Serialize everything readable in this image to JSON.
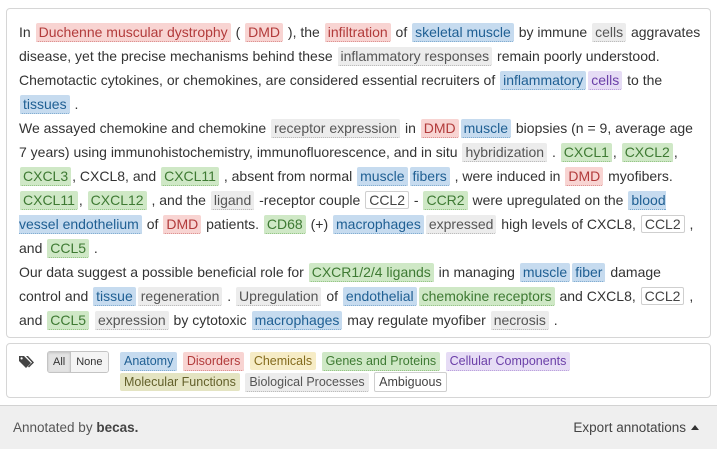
{
  "abstract": {
    "p1": {
      "s1": "In ",
      "e1": "Duchenne muscular dystrophy",
      "s2": " ( ",
      "e2": "DMD",
      "s3": " ), the ",
      "e3": "infiltration",
      "s4": " of ",
      "e4": "skeletal muscle",
      "s5": " by immune ",
      "e5": "cells",
      "s6": " aggravates disease, yet the precise mechanisms behind these ",
      "e6": "inflammatory responses",
      "s7": " remain poorly understood. Chemotactic cytokines, or chemokines, are considered essential recruiters of ",
      "e7a": "inflammatory",
      "e7b": "cells",
      "s8": " to the ",
      "e8": "tissues",
      "s9": " ."
    },
    "p2": {
      "s1": "We assayed chemokine and chemokine ",
      "e1": "receptor expression",
      "s2": " in ",
      "e2": "DMD",
      "e3": "muscle",
      "s3": " biopsies (n = 9, average age 7 years) using immunohistochemistry, immunofluorescence, and in situ ",
      "e4": "hybridization",
      "s4": " .",
      "g1": "CXCL1",
      "g2": "CXCL2",
      "g3": "CXCL3",
      "s5": ", CXCL8, and ",
      "g4": "CXCL11",
      "s6": " , absent from normal ",
      "e5": "muscle",
      "e6": "fibers",
      "s7": " , were induced in ",
      "e7": "DMD",
      "s8": " myofibers. ",
      "g5": "CXCL11",
      "g6": "CXCL12",
      "s9": " , and the ",
      "e8": "ligand",
      "s10": " -receptor couple ",
      "e9": "CCL2",
      "s11": " - ",
      "g7": "CCR2",
      "s12": " were upregulated on the ",
      "e10": "blood vessel endothelium",
      "s13": " of ",
      "e11": "DMD",
      "s14": " patients. ",
      "g8": "CD68",
      "s15": " (+) ",
      "e12": "macrophages",
      "e13": "expressed",
      "s16": " high levels of CXCL8, ",
      "e14": "CCL2",
      "s17": " , and ",
      "g9": "CCL5",
      "s18": " ."
    },
    "p3": {
      "s1": "Our data suggest a possible beneficial role for ",
      "g1": "CXCR1/2/4 ligands",
      "s2": " in managing ",
      "e1": "muscle",
      "e2": "fiber",
      "s3": " damage control and ",
      "e3": "tissue",
      "e4": "regeneration",
      "s4": " . ",
      "e5": "Upregulation",
      "s5": " of ",
      "e6": "endothelial",
      "e7": "chemokine receptors",
      "s6": " and CXCL8, ",
      "e8": "CCL2",
      "s7": " , and ",
      "g2": "CCL5",
      "e9": "expression",
      "s8": " by cytotoxic ",
      "e10": "macrophages",
      "s9": " may regulate myofiber ",
      "e11": "necrosis",
      "s10": " ."
    }
  },
  "legend": {
    "icon": "tags-icon",
    "all_label": "All",
    "none_label": "None",
    "items": [
      {
        "label": "Anatomy",
        "color": "#c6dbef"
      },
      {
        "label": "Disorders",
        "color": "#f8d4d2"
      },
      {
        "label": "Chemicals",
        "color": "#f6ecc6"
      },
      {
        "label": "Genes and Proteins",
        "color": "#cfe8c6"
      },
      {
        "label": "Cellular Components",
        "color": "#e6dcf5"
      },
      {
        "label": "Molecular Functions",
        "color": "#e4e4c2"
      },
      {
        "label": "Biological Processes",
        "color": "#ececec"
      },
      {
        "label": "Ambiguous",
        "color": "#ffffff"
      }
    ]
  },
  "footer": {
    "annotated_prefix": "Annotated by ",
    "annotated_brand": "becas.",
    "export_label": "Export annotations",
    "export_icon": "caret-up-icon"
  }
}
